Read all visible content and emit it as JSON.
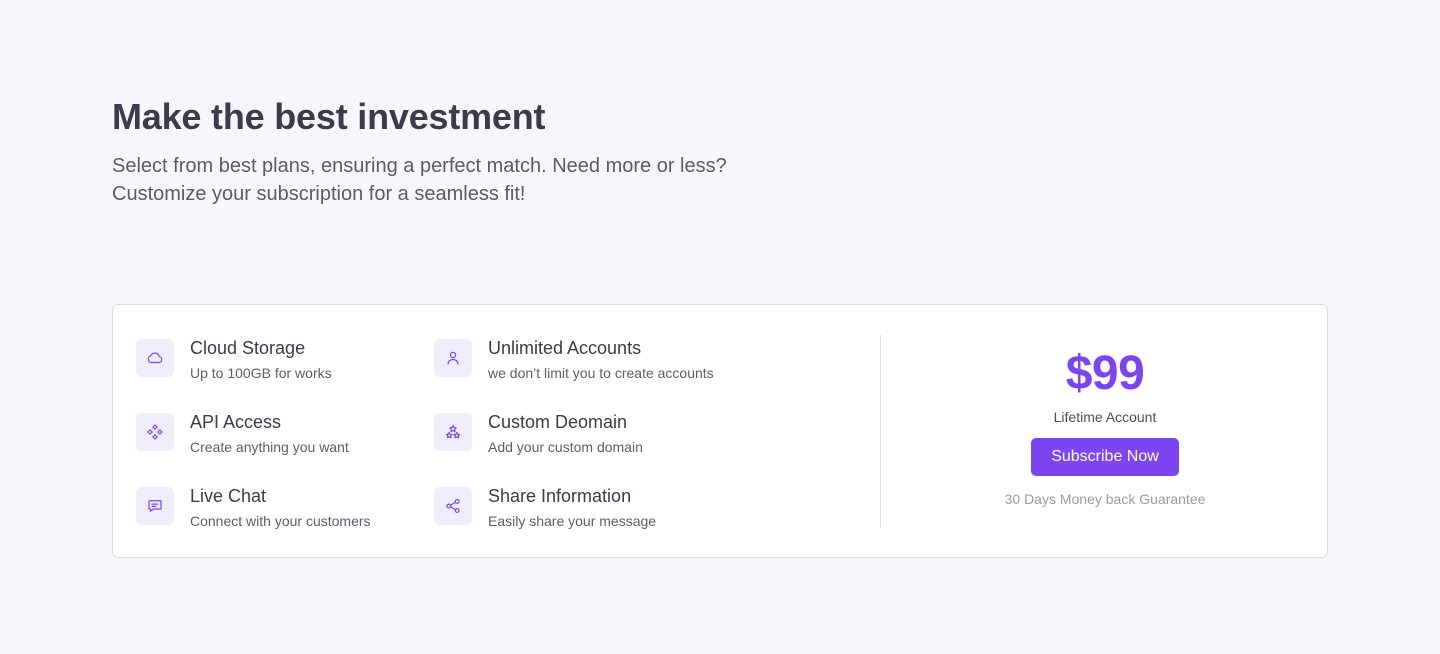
{
  "hero": {
    "title": "Make the best investment",
    "subtitle_line1": "Select from best plans, ensuring a perfect match. Need more or less?",
    "subtitle_line2": "Customize your subscription for a seamless fit!"
  },
  "features": [
    {
      "icon": "cloud-icon",
      "title": "Cloud Storage",
      "desc": "Up to 100GB for works"
    },
    {
      "icon": "user-icon",
      "title": "Unlimited Accounts",
      "desc": "we don’t limit you to create accounts"
    },
    {
      "icon": "api-icon",
      "title": "API Access",
      "desc": "Create anything you want"
    },
    {
      "icon": "domain-icon",
      "title": "Custom Deomain",
      "desc": "Add your custom domain"
    },
    {
      "icon": "chat-icon",
      "title": "Live Chat",
      "desc": "Connect with your customers"
    },
    {
      "icon": "share-icon",
      "title": "Share Information",
      "desc": "Easily share your message"
    }
  ],
  "pricing": {
    "price": "$99",
    "label": "Lifetime Account",
    "button_label": "Subscribe Now",
    "guarantee": "30 Days Money back Guarantee"
  },
  "colors": {
    "accent": "#7b45f2",
    "icon_bg": "#efecfb",
    "page_bg": "#f7f7fb"
  }
}
